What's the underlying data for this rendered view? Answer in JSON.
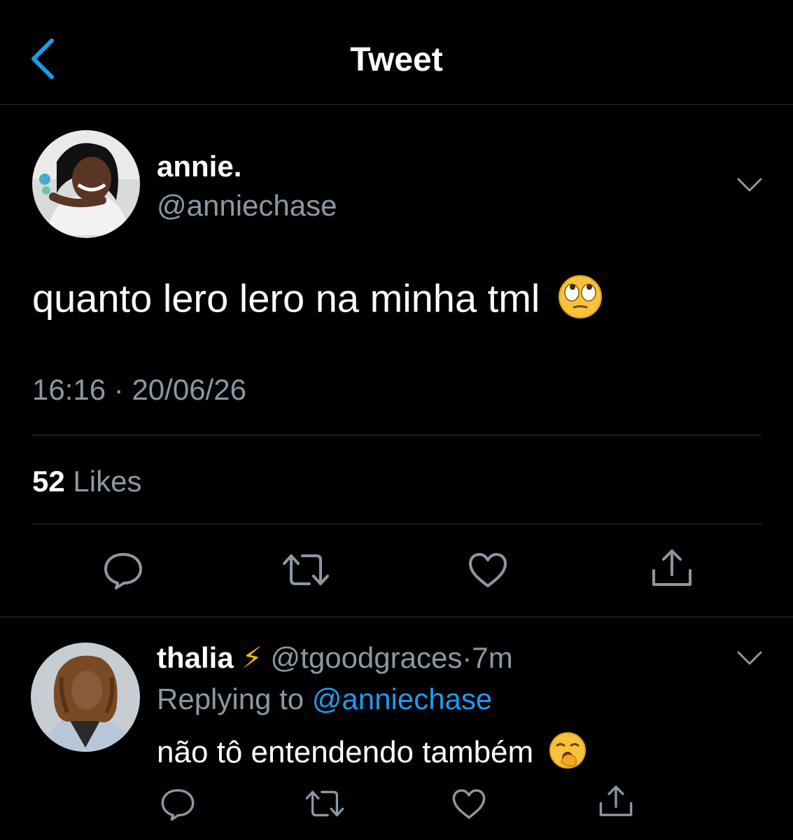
{
  "header": {
    "title": "Tweet",
    "back_icon": "chevron-left-icon"
  },
  "tweet": {
    "author_name": "annie.",
    "author_handle": "@anniechase",
    "text": "quanto lero lero na minha tml",
    "emoji": "rolling-eyes-emoji",
    "time": "16:16",
    "separator": "·",
    "date": "20/06/26",
    "likes_count": "52",
    "likes_label": "Likes"
  },
  "actions": [
    "reply-icon",
    "retweet-icon",
    "like-icon",
    "share-icon"
  ],
  "reply": {
    "author_name": "thalia",
    "badge": "⚡",
    "author_handle": "@tgoodgraces",
    "separator": "·",
    "time": "7m",
    "replying_prefix": "Replying to",
    "replying_to": "@anniechase",
    "text": "não tô entendendo também",
    "emoji": "yawning-face-emoji"
  },
  "colors": {
    "background": "#000000",
    "accent": "#1d9bf0",
    "muted": "#8b98a5",
    "divider": "#2f3336"
  }
}
